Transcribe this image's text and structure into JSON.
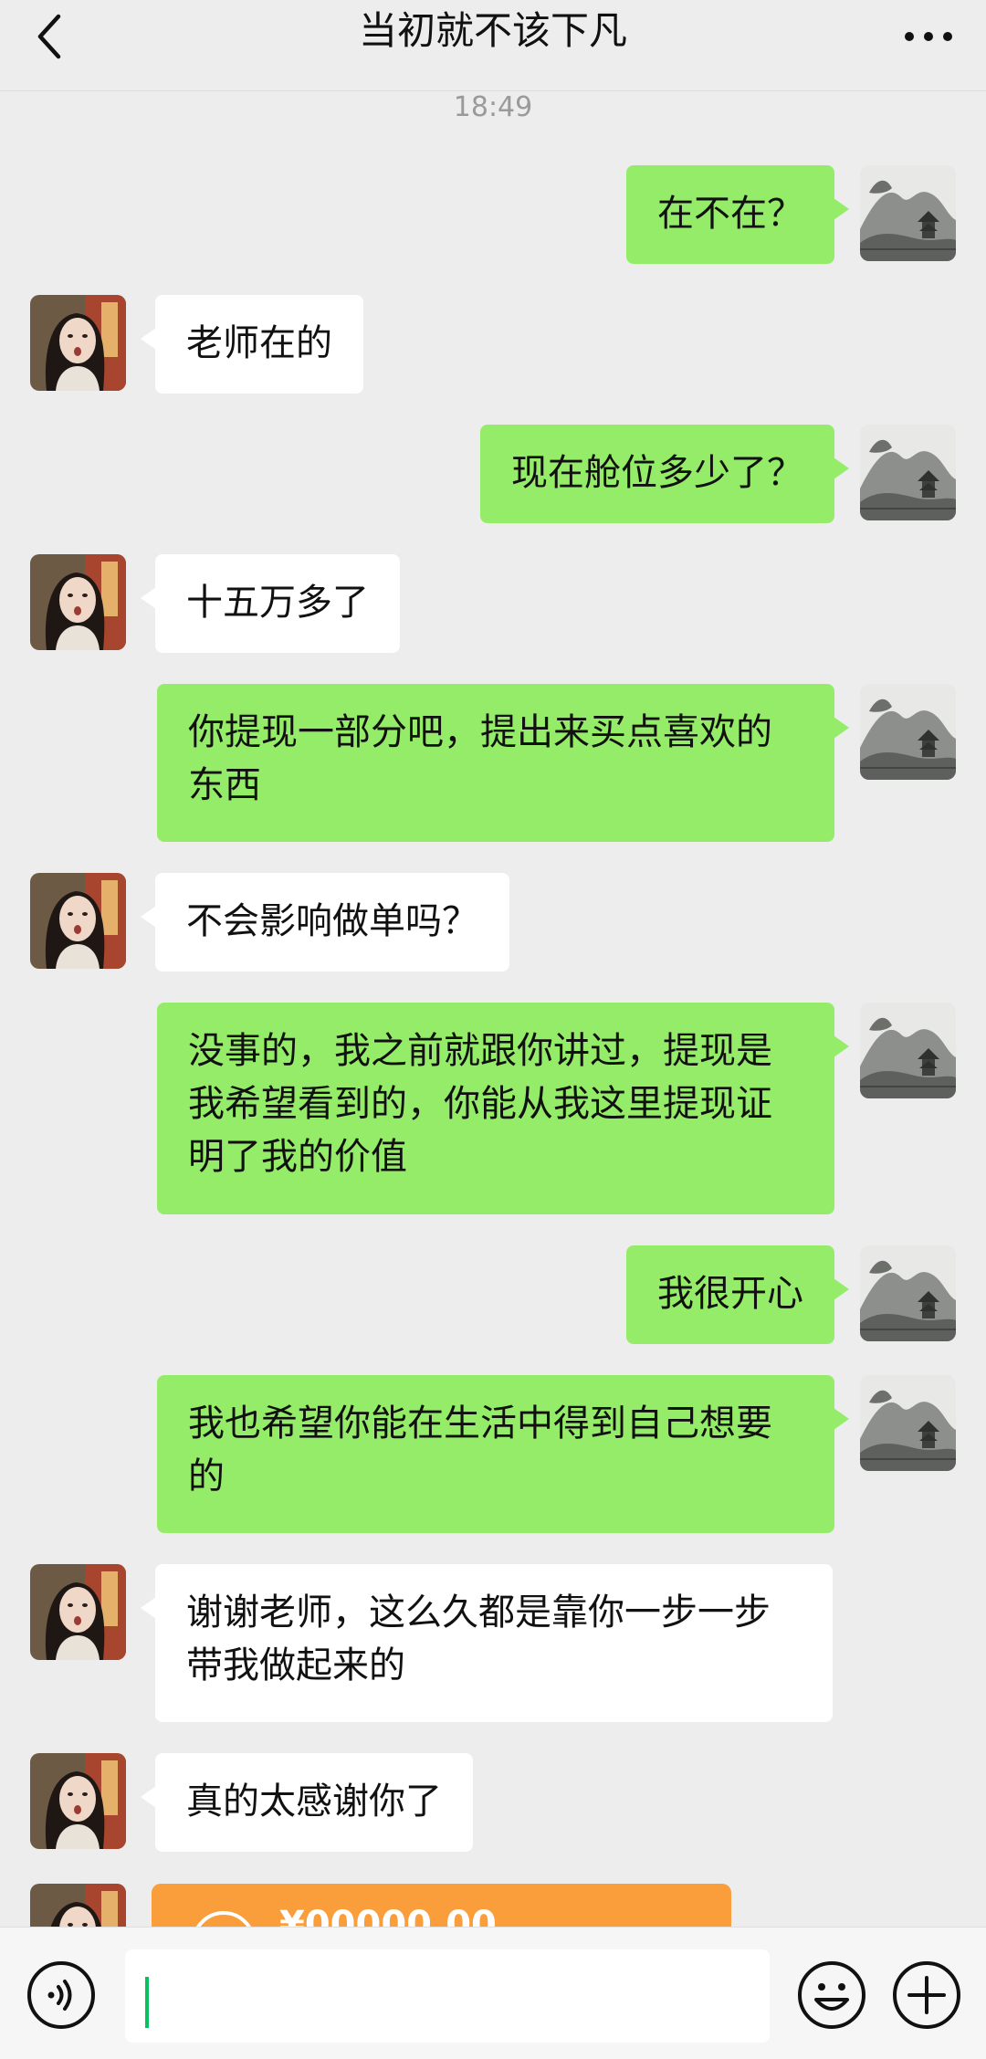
{
  "header": {
    "title": "当初就不该下凡"
  },
  "chat": {
    "timestamp": "18:49",
    "messages": [
      {
        "side": "out",
        "text": "在不在？"
      },
      {
        "side": "in",
        "text": "老师在的"
      },
      {
        "side": "out",
        "text": "现在舱位多少了？"
      },
      {
        "side": "in",
        "text": "十五万多了"
      },
      {
        "side": "out",
        "text": "你提现一部分吧，提出来买点喜欢的东西"
      },
      {
        "side": "in",
        "text": "不会影响做单吗？"
      },
      {
        "side": "out",
        "text": "没事的，我之前就跟你讲过，提现是我希望看到的，你能从我这里提现证明了我的价值"
      },
      {
        "side": "out",
        "text": "我很开心"
      },
      {
        "side": "out",
        "text": "我也希望你能在生活中得到自己想要的"
      },
      {
        "side": "in",
        "text": "谢谢老师，这么久都是靠你一步一步带我做起来的"
      },
      {
        "side": "in",
        "text": "真的太感谢你了"
      }
    ],
    "transfer": {
      "amount_partial": "¥00000.00"
    }
  },
  "icons": {
    "back": "chevron-left-icon",
    "more": "more-dots-icon",
    "voice": "voice-icon",
    "emoji": "emoji-icon",
    "plus": "plus-icon"
  },
  "colors": {
    "outgoing_bubble": "#95ec69",
    "incoming_bubble": "#ffffff",
    "background": "#ededed",
    "transfer": "#fa9d3b",
    "cursor": "#07c160"
  }
}
